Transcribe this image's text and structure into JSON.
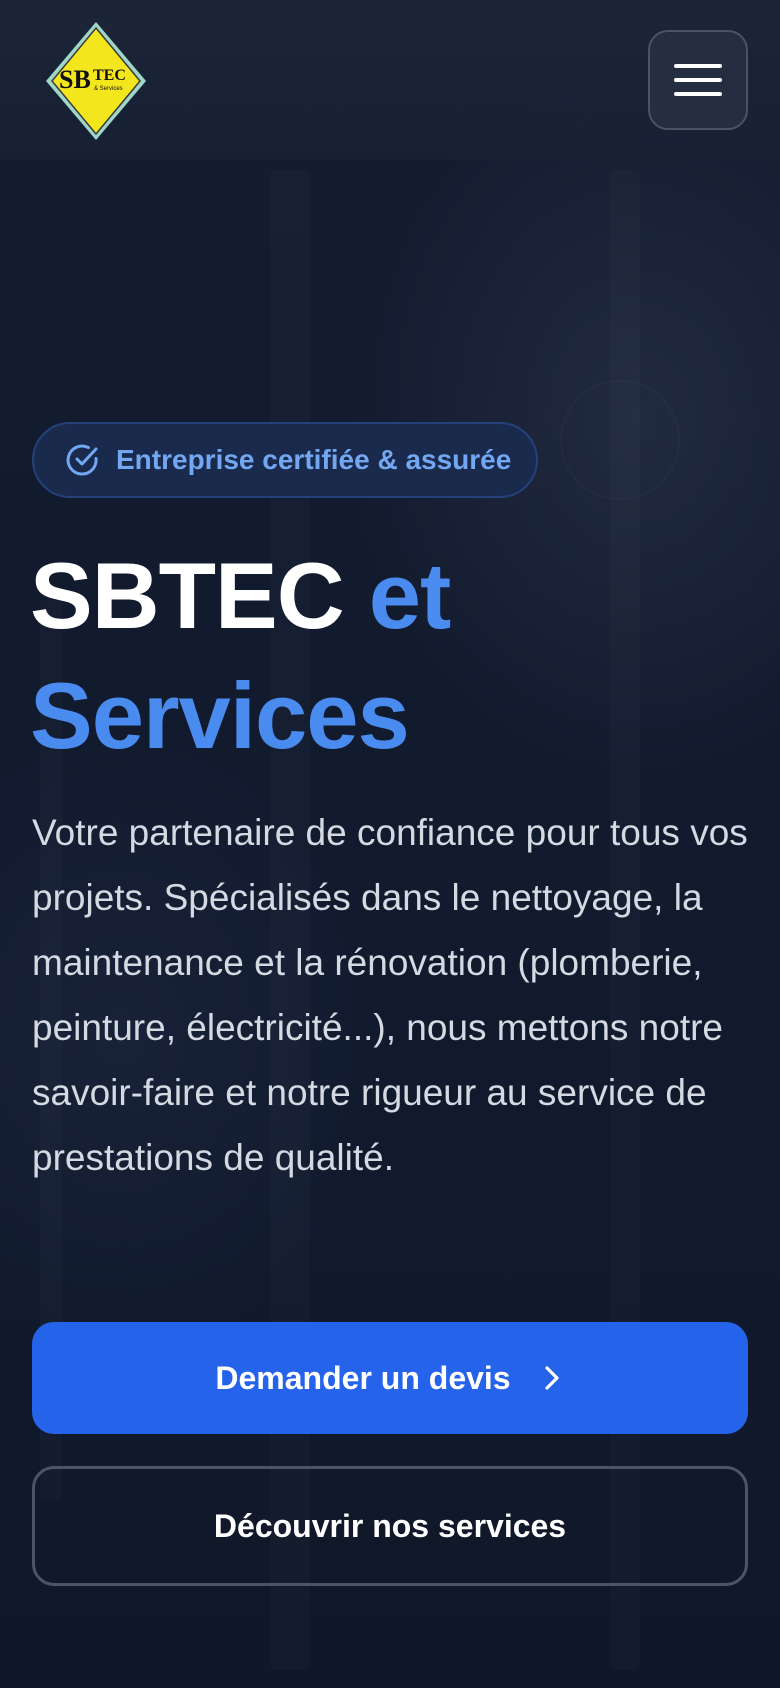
{
  "header": {
    "logo": {
      "text_main": "SB",
      "text_accent": "TEC",
      "text_small": "& Services"
    },
    "menu_icon": "hamburger-menu-icon"
  },
  "hero": {
    "badge": {
      "icon": "check-circle-icon",
      "label": "Entreprise certifiée & assurée"
    },
    "title": {
      "part_white": "SBTEC",
      "part_blue_1": "et",
      "part_blue_2": "Services"
    },
    "description": "Votre partenaire de confiance pour tous vos projets. Spécialisés dans le nettoyage, la maintenance et la rénovation (plomberie, peinture, électricité...), nous mettons notre savoir-faire et notre rigueur au service de prestations de qualité.",
    "primary_button": {
      "label": "Demander un devis",
      "icon": "chevron-right-icon"
    },
    "secondary_button": {
      "label": "Découvrir nos services"
    }
  },
  "colors": {
    "background": "#111a2e",
    "accent_blue": "#4a8bf0",
    "primary_button": "#2563eb",
    "badge_text": "#73a7f2",
    "logo_yellow": "#f4e61c"
  }
}
